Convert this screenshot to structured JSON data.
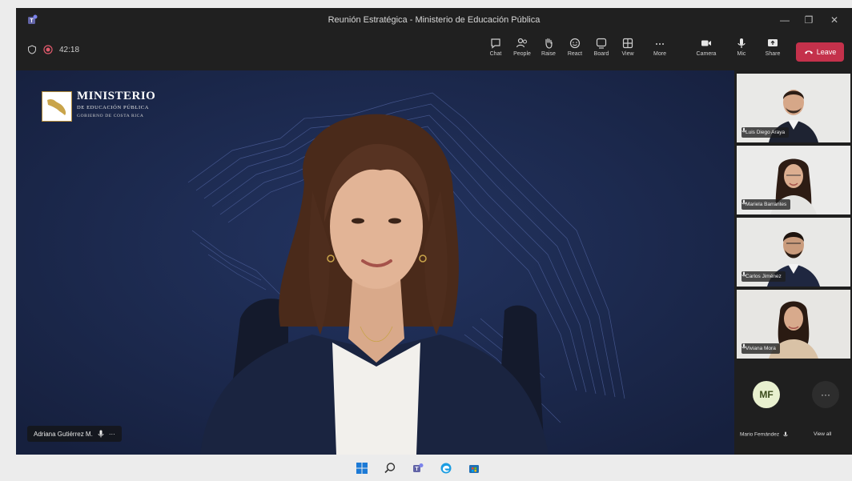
{
  "window": {
    "title": "Reunión Estratégica - Ministerio de Educación Pública",
    "minimize": "—",
    "maximize": "❐",
    "close": "✕"
  },
  "toolbar": {
    "timer": "42:18",
    "items": [
      {
        "label": "Chat",
        "icon": "chat-icon"
      },
      {
        "label": "People",
        "icon": "people-icon"
      },
      {
        "label": "Raise",
        "icon": "raise-hand-icon"
      },
      {
        "label": "React",
        "icon": "react-icon"
      },
      {
        "label": "Board",
        "icon": "board-icon"
      },
      {
        "label": "View",
        "icon": "view-icon"
      },
      {
        "label": "More",
        "icon": "more-icon"
      },
      {
        "label": "Camera",
        "icon": "camera-icon"
      },
      {
        "label": "Mic",
        "icon": "mic-icon"
      },
      {
        "label": "Share",
        "icon": "share-icon"
      }
    ],
    "leave_label": "Leave"
  },
  "stage": {
    "logo": {
      "line1": "MINISTERIO",
      "line2": "DE EDUCACIÓN PÚBLICA",
      "line3": "GOBIERNO DE COSTA RICA"
    },
    "speaker_name": "Adriana Gutiérrez M.",
    "speaker_more": "···"
  },
  "participants": [
    {
      "name": "Luis Diego Araya"
    },
    {
      "name": "Mariela Barrantes"
    },
    {
      "name": "Carlos Jiménez"
    },
    {
      "name": "Viviana Mora"
    }
  ],
  "overflow": {
    "initials": "MF",
    "name": "Mario Fernández",
    "more": "···",
    "view_all": "View all"
  },
  "colors": {
    "stage_bg": "#1d2a4e",
    "leave": "#c4314b",
    "teams_purple": "#6264a7"
  }
}
